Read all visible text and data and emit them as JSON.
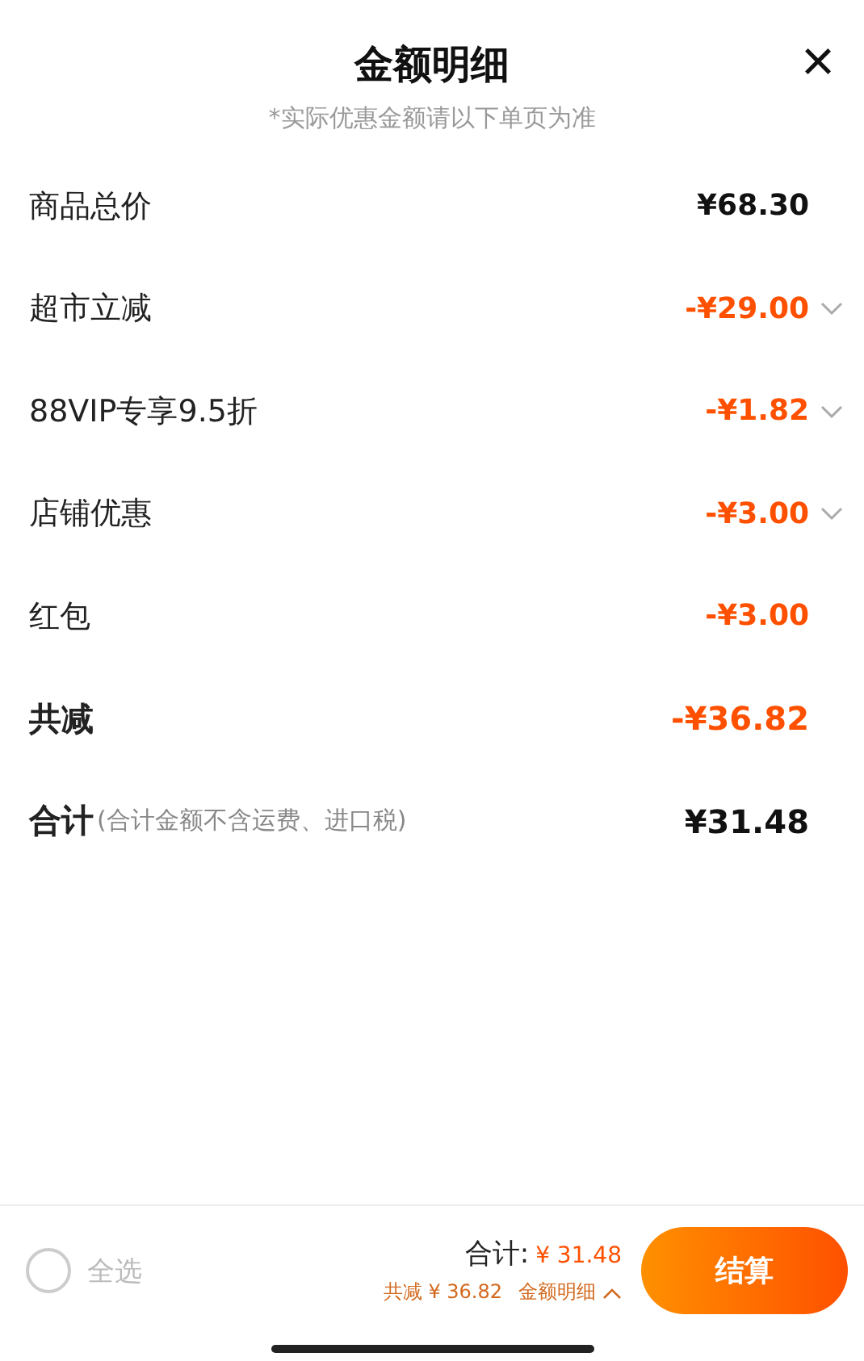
{
  "header": {
    "title": "金额明细",
    "subtitle": "*实际优惠金额请以下单页为准",
    "close": "×"
  },
  "rows": [
    {
      "label": "商品总价",
      "value": "¥68.30",
      "bold": false,
      "kind": "price",
      "expandable": false
    },
    {
      "label": "超市立减",
      "value": "-¥29.00",
      "bold": false,
      "kind": "discount",
      "expandable": true
    },
    {
      "label": "88VIP专享9.5折",
      "value": "-¥1.82",
      "bold": false,
      "kind": "discount",
      "expandable": true
    },
    {
      "label": "店铺优惠",
      "value": "-¥3.00",
      "bold": false,
      "kind": "discount",
      "expandable": true
    },
    {
      "label": "红包",
      "value": "-¥3.00",
      "bold": false,
      "kind": "discount",
      "expandable": false
    },
    {
      "label": "共减",
      "value": "-¥36.82",
      "bold": true,
      "kind": "discount",
      "expandable": false
    },
    {
      "label": "合计",
      "note": "(合计金额不含运费、进口税)",
      "value": "¥31.48",
      "bold": true,
      "kind": "price",
      "expandable": false
    }
  ],
  "footer": {
    "select_all": {
      "label": "全选",
      "checked": false
    },
    "total_label": "合计:",
    "total_value": "¥ 31.48",
    "saved": "共减 ¥ 36.82",
    "detail_link": "金额明细",
    "detail_expanded": true,
    "checkout": "结算"
  }
}
